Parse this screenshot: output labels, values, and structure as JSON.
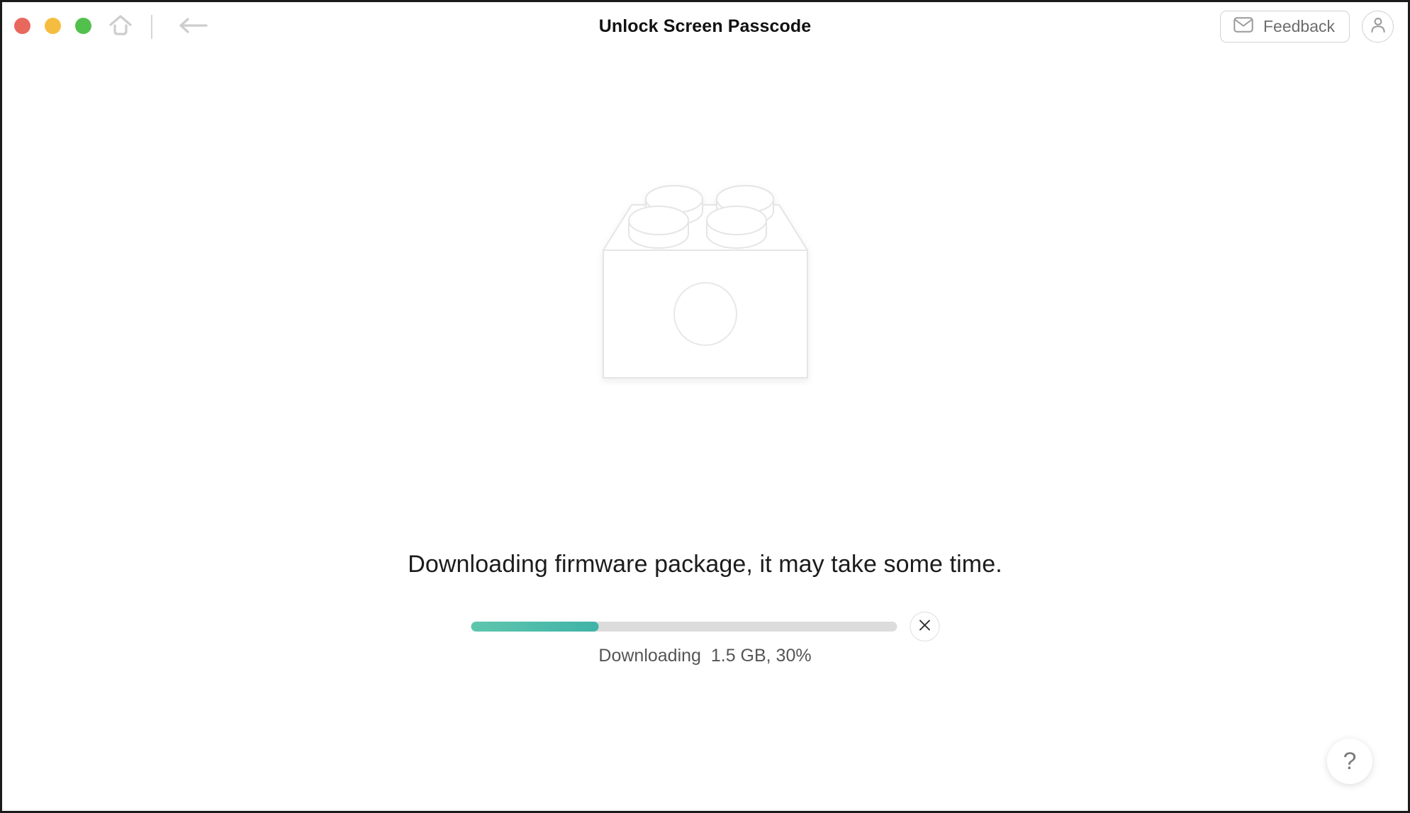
{
  "window": {
    "title": "Unlock Screen Passcode",
    "traffic_lights": [
      {
        "name": "close",
        "color": "#e8685e"
      },
      {
        "name": "minimize",
        "color": "#f5bd40"
      },
      {
        "name": "maximize",
        "color": "#52c04c"
      }
    ],
    "nav": {
      "home_icon": "home-icon",
      "back_icon": "back-arrow-icon"
    },
    "feedback": {
      "label": "Feedback",
      "icon": "envelope-icon"
    },
    "account": {
      "icon": "user-avatar-icon"
    }
  },
  "main": {
    "illustration": {
      "name": "firmware-brick-illustration",
      "stroke_color": "#e3e3e3"
    },
    "status_title": "Downloading firmware package, it may take some time.",
    "progress": {
      "percent": 30,
      "fill_start_color": "#5fc6ad",
      "fill_end_color": "#3fb3a8",
      "track_color": "#dcdcdc",
      "cancel_icon": "close-x-icon"
    },
    "progress_status": "Downloading  1.5 GB, 30%",
    "help": {
      "label": "?",
      "icon": "question-mark-icon"
    }
  }
}
